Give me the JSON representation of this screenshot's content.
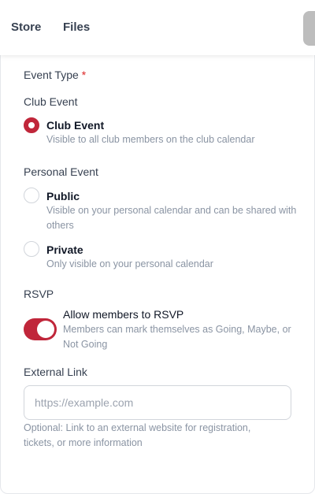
{
  "nav": {
    "store": "Store",
    "files": "Files"
  },
  "form": {
    "event_type_label": "Event Type",
    "required_marker": "*",
    "club_section": "Club Event",
    "club_option": {
      "title": "Club Event",
      "desc": "Visible to all club members on the club calendar",
      "selected": true
    },
    "personal_section": "Personal Event",
    "public_option": {
      "title": "Public",
      "desc": "Visible on your personal calendar and can be shared with others",
      "selected": false
    },
    "private_option": {
      "title": "Private",
      "desc": "Only visible on your personal calendar",
      "selected": false
    },
    "rsvp_label": "RSVP",
    "rsvp_toggle": {
      "title": "Allow members to RSVP",
      "desc": "Members can mark themselves as Going, Maybe, or Not Going",
      "on": true
    },
    "external_link_label": "External Link",
    "external_link_placeholder": "https://example.com",
    "external_link_value": "",
    "external_link_help": "Optional: Link to an external website for registration, tickets, or more information"
  },
  "colors": {
    "accent": "#c0263a",
    "required": "#dc2626"
  }
}
